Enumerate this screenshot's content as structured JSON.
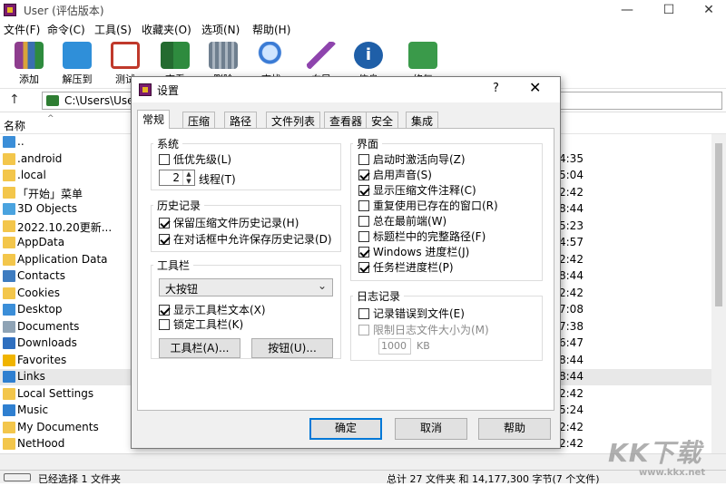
{
  "window": {
    "title": "User (评估版本)"
  },
  "menu": [
    "文件(F)",
    "命令(C)",
    "工具(S)",
    "收藏夹(O)",
    "选项(N)",
    "帮助(H)"
  ],
  "toolbar": [
    {
      "label": "添加",
      "icon": "archive-add-icon",
      "color": "#8e3d8e"
    },
    {
      "label": "解压到",
      "icon": "folder-extract-icon",
      "color": "#2f8fd9"
    },
    {
      "label": "测试",
      "icon": "clipboard-check-icon",
      "color": "#c0392b"
    },
    {
      "label": "查看",
      "icon": "book-view-icon",
      "color": "#2e8b3e"
    },
    {
      "label": "删除",
      "icon": "trash-icon",
      "color": "#6f7f8f"
    },
    {
      "label": "查找",
      "icon": "magnifier-icon",
      "color": "#3a7bd5"
    },
    {
      "label": "向导",
      "icon": "magic-wand-icon",
      "color": "#8e44ad"
    },
    {
      "label": "信息",
      "icon": "info-icon",
      "color": "#1f5fa8"
    },
    {
      "label": "修复",
      "icon": "repair-book-icon",
      "color": "#3a9a4a"
    }
  ],
  "address": {
    "path": "C:\\Users\\User"
  },
  "list": {
    "header_name": "名称",
    "files": [
      {
        "name": "..",
        "time": "",
        "icon": "drive-up-icon",
        "color": "#3b8ed8"
      },
      {
        "name": ".android",
        "time": "4:35",
        "icon": "folder-icon",
        "color": "#f3c64b"
      },
      {
        "name": ".local",
        "time": "5:04",
        "icon": "folder-icon",
        "color": "#f3c64b"
      },
      {
        "name": "「开始」菜单",
        "time": "2:42",
        "icon": "folder-icon",
        "color": "#f3c64b"
      },
      {
        "name": "3D Objects",
        "time": "8:44",
        "icon": "cube-folder-icon",
        "color": "#4aa3df"
      },
      {
        "name": "2022.10.20更新...",
        "time": "5:23",
        "icon": "folder-icon",
        "color": "#f3c64b"
      },
      {
        "name": "AppData",
        "time": "4:57",
        "icon": "folder-icon",
        "color": "#f3c64b"
      },
      {
        "name": "Application Data",
        "time": "2:42",
        "icon": "folder-icon",
        "color": "#f3c64b"
      },
      {
        "name": "Contacts",
        "time": "8:44",
        "icon": "contacts-folder-icon",
        "color": "#3e7cc0"
      },
      {
        "name": "Cookies",
        "time": "2:42",
        "icon": "folder-icon",
        "color": "#f3c64b"
      },
      {
        "name": "Desktop",
        "time": "7:08",
        "icon": "desktop-folder-icon",
        "color": "#3b8ed8"
      },
      {
        "name": "Documents",
        "time": "7:38",
        "icon": "documents-folder-icon",
        "color": "#8fa3b5"
      },
      {
        "name": "Downloads",
        "time": "6:47",
        "icon": "downloads-folder-icon",
        "color": "#2f6fbf"
      },
      {
        "name": "Favorites",
        "time": "8:44",
        "icon": "star-folder-icon",
        "color": "#f0b400"
      },
      {
        "name": "Links",
        "time": "8:44",
        "icon": "link-folder-icon",
        "color": "#2f7fd0",
        "selected": true
      },
      {
        "name": "Local Settings",
        "time": "2:42",
        "icon": "folder-icon",
        "color": "#f3c64b"
      },
      {
        "name": "Music",
        "time": "5:24",
        "icon": "music-folder-icon",
        "color": "#2f7fd0"
      },
      {
        "name": "My Documents",
        "time": "2:42",
        "icon": "folder-icon",
        "color": "#f3c64b"
      },
      {
        "name": "NetHood",
        "time": "2:42",
        "icon": "folder-icon",
        "color": "#f3c64b"
      }
    ]
  },
  "status": {
    "left": "已经选择 1 文件夹",
    "right": "总计 27 文件夹 和 14,177,300 字节(7 个文件)"
  },
  "watermark": {
    "big": "KK下载",
    "small": "www.kkx.net"
  },
  "dialog": {
    "title": "设置",
    "help": "?",
    "close": "✕",
    "tabs": [
      "常规",
      "压缩",
      "路径",
      "文件列表",
      "查看器",
      "安全",
      "集成"
    ],
    "system": {
      "title": "系统",
      "low_priority": "低优先级(L)",
      "threads_value": "2",
      "threads_label": "线程(T)"
    },
    "history": {
      "title": "历史记录",
      "keep_history": "保留压缩文件历史记录(H)",
      "allow_dialog_history": "在对话框中允许保存历史记录(D)"
    },
    "toolbar": {
      "title": "工具栏",
      "size_value": "大按钮",
      "show_text": "显示工具栏文本(X)",
      "lock": "锁定工具栏(K)",
      "toolbar_btn": "工具栏(A)...",
      "buttons_btn": "按钮(U)..."
    },
    "interface": {
      "title": "界面",
      "items": [
        {
          "label": "启动时激活向导(Z)",
          "checked": false
        },
        {
          "label": "启用声音(S)",
          "checked": true
        },
        {
          "label": "显示压缩文件注释(C)",
          "checked": true
        },
        {
          "label": "重复使用已存在的窗口(R)",
          "checked": false
        },
        {
          "label": "总在最前端(W)",
          "checked": false
        },
        {
          "label": "标题栏中的完整路径(F)",
          "checked": false
        },
        {
          "label": "Windows 进度栏(J)",
          "checked": true
        },
        {
          "label": "任务栏进度栏(P)",
          "checked": true
        }
      ]
    },
    "log": {
      "title": "日志记录",
      "log_errors": "记录错误到文件(E)",
      "limit_size": "限制日志文件大小为(M)",
      "size_value": "1000",
      "size_unit": "KB"
    },
    "buttons": {
      "ok": "确定",
      "cancel": "取消",
      "help": "帮助"
    }
  }
}
